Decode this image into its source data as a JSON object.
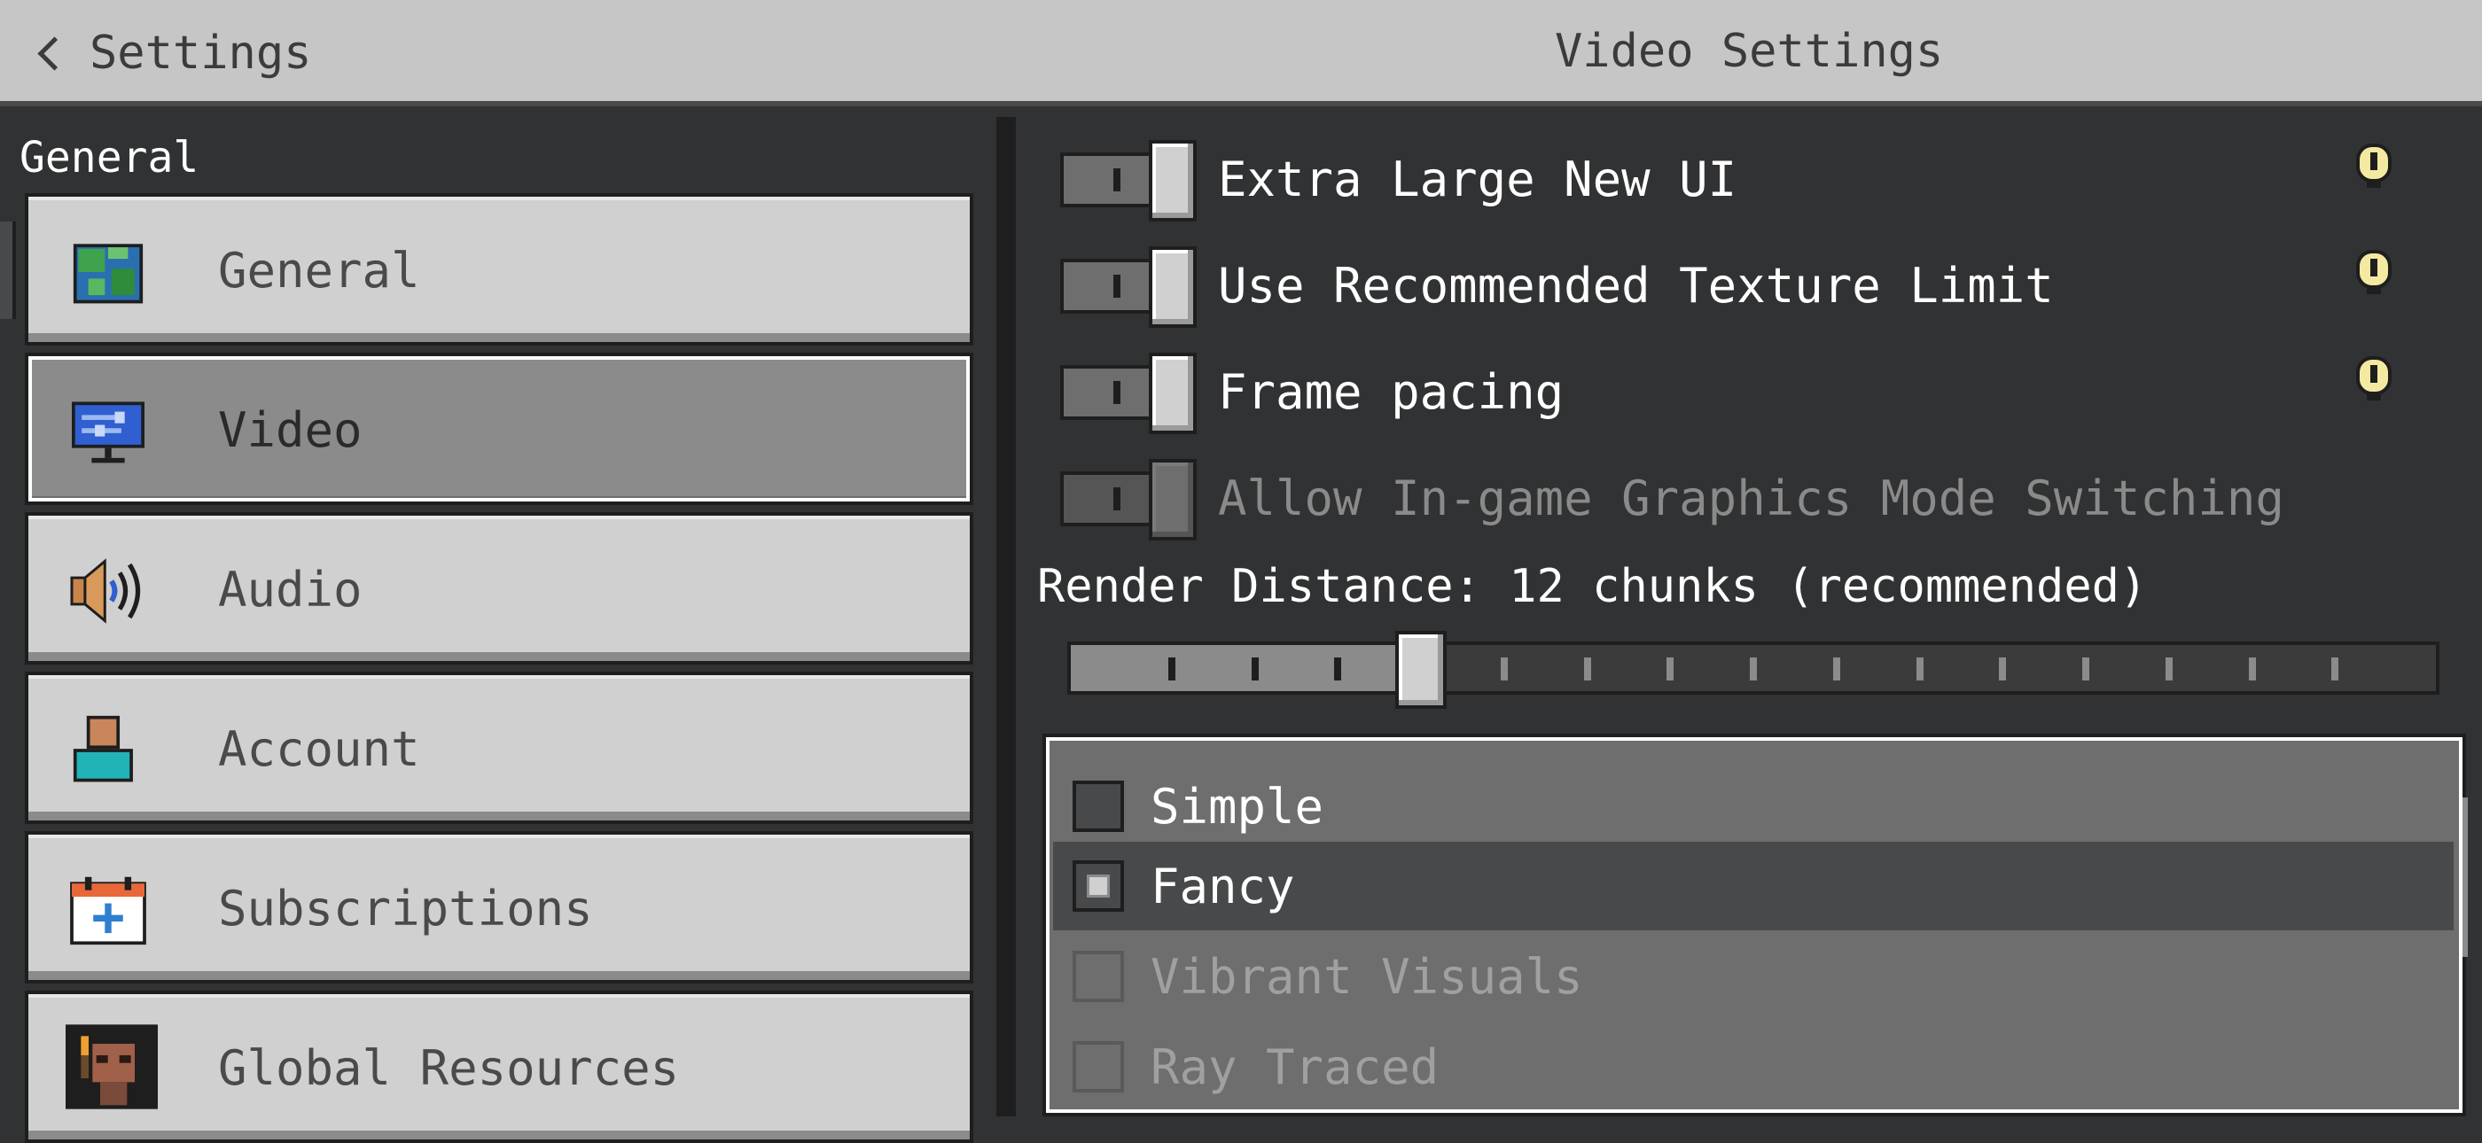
{
  "header": {
    "back_label": "Settings",
    "title": "Video Settings"
  },
  "sidebar": {
    "section_label": "General",
    "items": [
      {
        "label": "General",
        "icon": "globe-icon",
        "selected": false
      },
      {
        "label": "Video",
        "icon": "monitor-icon",
        "selected": true
      },
      {
        "label": "Audio",
        "icon": "speaker-icon",
        "selected": false
      },
      {
        "label": "Account",
        "icon": "user-icon",
        "selected": false
      },
      {
        "label": "Subscriptions",
        "icon": "calendar-plus-icon",
        "selected": false
      },
      {
        "label": "Global Resources",
        "icon": "resource-pack-icon",
        "selected": false
      }
    ]
  },
  "toggles": [
    {
      "label": "Extra Large New UI",
      "on": true,
      "enabled": true,
      "info": true
    },
    {
      "label": "Use Recommended Texture Limit",
      "on": true,
      "enabled": true,
      "info": true
    },
    {
      "label": "Frame pacing",
      "on": true,
      "enabled": true,
      "info": true
    },
    {
      "label": "Allow In-game Graphics Mode Switching",
      "on": true,
      "enabled": false,
      "info": false
    }
  ],
  "render_distance": {
    "label": "Render Distance: 12 chunks (recommended)",
    "value": 12,
    "min": 4,
    "max": 36,
    "step": 2
  },
  "graphics_mode": {
    "options": [
      {
        "label": "Simple",
        "selected": false,
        "enabled": true
      },
      {
        "label": "Fancy",
        "selected": true,
        "enabled": true
      },
      {
        "label": "Vibrant Visuals",
        "selected": false,
        "enabled": false
      },
      {
        "label": "Ray Traced",
        "selected": false,
        "enabled": false
      }
    ]
  },
  "colors": {
    "background": "#313233",
    "button": "#d0d0d0",
    "button_selected": "#8b8b8b",
    "topbar": "#c6c6c6",
    "info_icon": "#f4e9a0"
  }
}
